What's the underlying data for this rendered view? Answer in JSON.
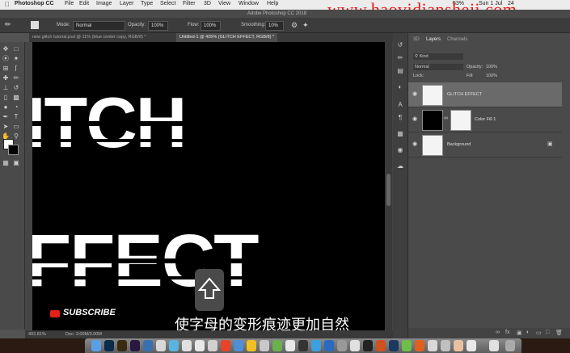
{
  "menubar": {
    "apple": "",
    "app": "Photoshop CC",
    "items": [
      "File",
      "Edit",
      "Image",
      "Layer",
      "Type",
      "Select",
      "Filter",
      "3D",
      "View",
      "Window",
      "Help"
    ],
    "window_title": "Adobe Photoshop CC 2018",
    "status_battery": "53%",
    "status_date": "Sun 1 Jul",
    "status_time": "24",
    "watermark": "www.haovidiansheji.com"
  },
  "options": {
    "mode_label": "Mode:",
    "mode_value": "Normal",
    "opacity_label": "Opacity:",
    "opacity_value": "100%",
    "flow_label": "Flow:",
    "flow_value": "100%",
    "smoothing_label": "Smoothing:",
    "smoothing_value": "10%"
  },
  "tabs": [
    {
      "label": "new glitch tutorial.psd @ 11% (blue center copy, RGB/8) *",
      "active": false
    },
    {
      "label": "Untitled-1 @ 405% (GLITCH EFFECT, RGB/8) *",
      "active": true
    }
  ],
  "canvas": {
    "line1": "ITCH",
    "line2": "FFECT",
    "subscribe": "SUBSCRIBE",
    "subtitle": "使字母的变形痕迹更加自然"
  },
  "status": {
    "zoom": "402.81%",
    "doc": "Doc: 3.00M/3.00M"
  },
  "panel": {
    "tabs": [
      "3D",
      "Layers",
      "Channels"
    ],
    "active_tab": "Layers",
    "filter_label": "Kind",
    "blend_mode": "Normal",
    "opacity_label": "Opacity:",
    "opacity_value": "100%",
    "lock_label": "Lock:",
    "fill_label": "Fill:",
    "fill_value": "100%",
    "layers": [
      {
        "name": "GLITCH EFFECT",
        "selected": true
      },
      {
        "name": "Color Fill 1",
        "selected": false
      },
      {
        "name": "Background",
        "selected": false
      }
    ]
  },
  "colors": {
    "ps_blue": "#31a8ff",
    "watermark_red": "#e21a1a"
  }
}
